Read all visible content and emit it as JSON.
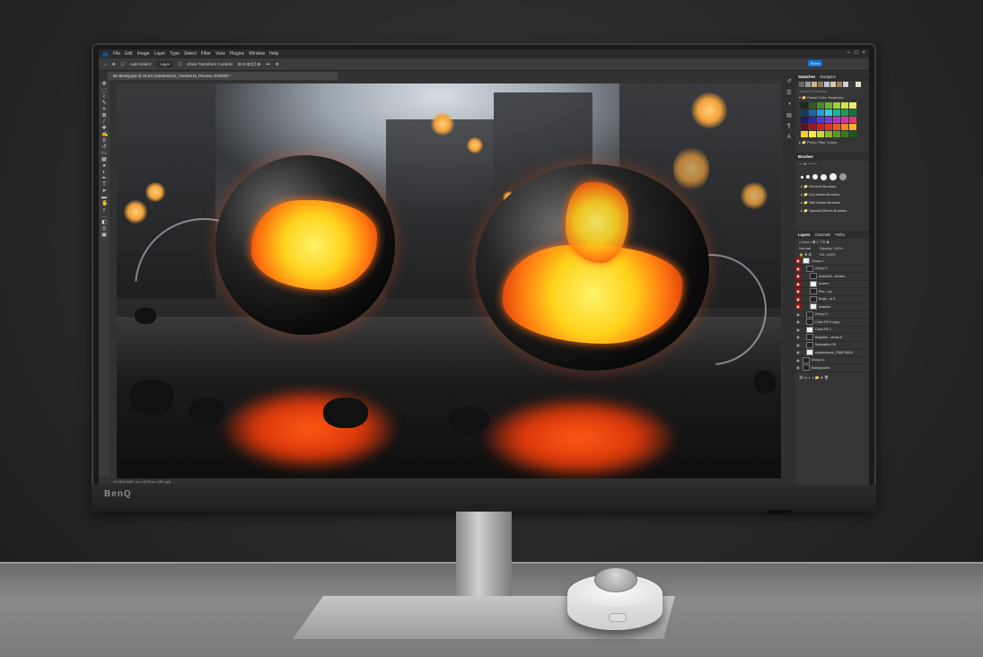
{
  "monitor": {
    "brand": "BenQ"
  },
  "app": {
    "menu": [
      "File",
      "Edit",
      "Image",
      "Layer",
      "Type",
      "Select",
      "Filter",
      "View",
      "Plugins",
      "Window",
      "Help"
    ],
    "options": {
      "auto_select": "Auto-Select:",
      "target": "Layer",
      "transform": "Show Transform Controls",
      "share": "Share"
    },
    "document_tab": "5K-BENQ.psd @ 25.6% (AdobeStock_731185415_Preview, RGB/8#) *",
    "status": "25.68%   8467 px x 4870 px (150 ppi)"
  },
  "panels": {
    "swatches": {
      "tabs": [
        "Swatches",
        "Navigator"
      ],
      "search_placeholder": "Search Swatches",
      "group1": "Pastel Color Swatches",
      "group2": "Photo Filter Colors",
      "recent": [
        "#6a6a6a",
        "#9a9a9a",
        "#c9b28f",
        "#8a7a5a",
        "#b9c3cf",
        "#d7c7a7",
        "#a17b5b",
        "#cfcfcf",
        "#3d3d3d",
        "#e9e2d2"
      ],
      "grid": [
        "#1a2a1a",
        "#2d5a1e",
        "#4b8a2a",
        "#6fb12f",
        "#9ccf3a",
        "#cfe24a",
        "#e8ec6a",
        "#123a6a",
        "#1a6aa8",
        "#21a0d8",
        "#2fd0e0",
        "#14b896",
        "#1fa05a",
        "#0e7a3a",
        "#1a1a6a",
        "#2a2ab0",
        "#4a3ae0",
        "#7a3ad8",
        "#a83ac0",
        "#d03aa0",
        "#e03a6a",
        "#6a0e1a",
        "#a8121e",
        "#d81e22",
        "#e8321a",
        "#f05a1e",
        "#f08a1e",
        "#f0b42a",
        "#f8d02a",
        "#f8e84a",
        "#c8d82a",
        "#8ab81e",
        "#5a9a1e",
        "#3a7a1e",
        "#1a5a1e"
      ]
    },
    "brushes": {
      "tab": "Brushes",
      "folders": [
        "General Brushes",
        "Dry Media Brushes",
        "Wet Media Brushes",
        "Special Effects Brushes"
      ]
    },
    "layers": {
      "tabs": [
        "Layers",
        "Channels",
        "Paths"
      ],
      "kind": "Kind",
      "blend": "Normal",
      "opacity_label": "Opacity:",
      "opacity": "100%",
      "fill_label": "Fill:",
      "fill": "100%",
      "rows": [
        {
          "name": "Group 1",
          "indent": 0,
          "visible": true
        },
        {
          "name": "Group 2",
          "indent": 1,
          "visible": true
        },
        {
          "name": "AdobeSt...review",
          "indent": 2,
          "visible": true
        },
        {
          "name": "screen",
          "indent": 2,
          "visible": true
        },
        {
          "name": "Fire...ow",
          "indent": 2,
          "visible": true
        },
        {
          "name": "Brigh...st 3",
          "indent": 2,
          "visible": true
        },
        {
          "name": "shadow",
          "indent": 2,
          "visible": true
        },
        {
          "name": "Group 3",
          "indent": 1,
          "visible": false
        },
        {
          "name": "Color Fill 3 copy",
          "indent": 1,
          "visible": false
        },
        {
          "name": "Color Fill 1",
          "indent": 1,
          "visible": false
        },
        {
          "name": "Brightne...ntrast 6",
          "indent": 1,
          "visible": false
        },
        {
          "name": "Saturation Fill",
          "indent": 1,
          "visible": false
        },
        {
          "name": "shutterstock_236874808",
          "indent": 1,
          "visible": false
        },
        {
          "name": "Group 4",
          "indent": 0,
          "visible": false
        },
        {
          "name": "Background",
          "indent": 0,
          "visible": false
        }
      ]
    }
  }
}
